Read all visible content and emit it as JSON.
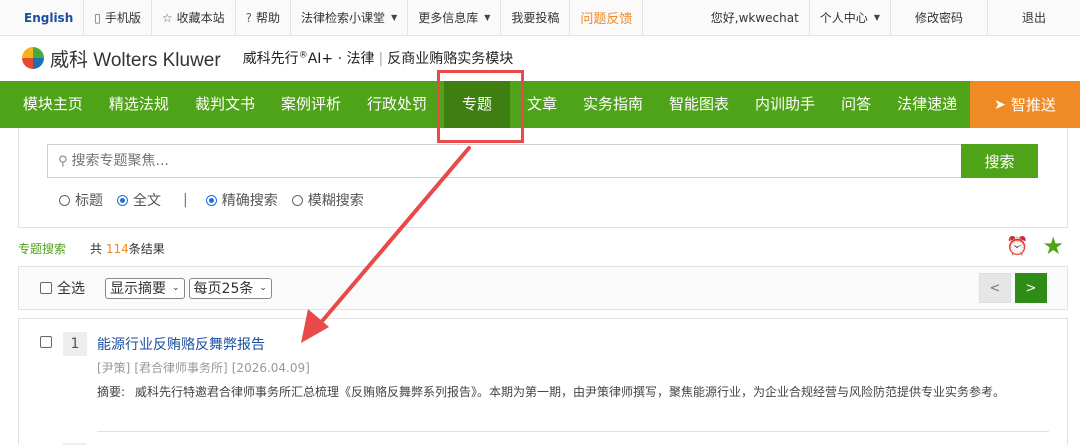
{
  "topbar": {
    "english": "English",
    "mobile": "手机版",
    "bookmark": "收藏本站",
    "help": "帮助",
    "class": "法律检索小课堂",
    "more": "更多信息库",
    "submit": "我要投稿",
    "feedback": "问题反馈",
    "greeting": "您好,wkwechat",
    "center": "个人中心",
    "password": "修改密码",
    "logout": "退出"
  },
  "header": {
    "brand": "威科 Wolters Kluwer",
    "product_pre": "威科先行",
    "product_sup": "®",
    "product_post": "AI+ · 法律",
    "module": "反商业贿赂实务模块"
  },
  "nav": {
    "items": [
      "模块主页",
      "精选法规",
      "裁判文书",
      "案例评析",
      "行政处罚",
      "专题",
      "文章",
      "实务指南",
      "智能图表",
      "内训助手",
      "问答",
      "法律速递"
    ],
    "active": "专题",
    "push": "智推送"
  },
  "search": {
    "placeholder": "搜索专题聚焦...",
    "button": "搜索",
    "options": [
      "标题",
      "全文",
      "精确搜索",
      "模糊搜索"
    ],
    "selected_scope": "全文",
    "selected_mode": "精确搜索"
  },
  "meta": {
    "tab": "专题搜索",
    "prefix": "共",
    "count": "114",
    "suffix": "条结果"
  },
  "toolbar": {
    "select_all": "全选",
    "display": "显示摘要",
    "per_page": "每页25条",
    "prev": "<",
    "next": ">"
  },
  "results": [
    {
      "index": "1",
      "title": "能源行业反贿赂反舞弊报告",
      "author": "[尹策]",
      "firm": "[君合律师事务所]",
      "date": "[2026.04.09]",
      "summary_label": "摘要:",
      "summary": "威科先行特邀君合律师事务所汇总梳理《反贿赂反舞弊系列报告》。本期为第一期，由尹策律师撰写，聚焦能源行业，为企业合规经营与风险防范提供专业实务参考。"
    }
  ],
  "colors": {
    "nav_green": "#4fa318",
    "nav_active": "#3f7f11",
    "accent_orange": "#f08a24",
    "link_blue": "#1b4fa0",
    "annotation_red": "#e84a4a"
  },
  "icons": [
    "phone-icon",
    "star-outline-icon",
    "help-icon",
    "search-icon",
    "alarm-clock-icon",
    "star-icon",
    "paper-plane-icon"
  ]
}
